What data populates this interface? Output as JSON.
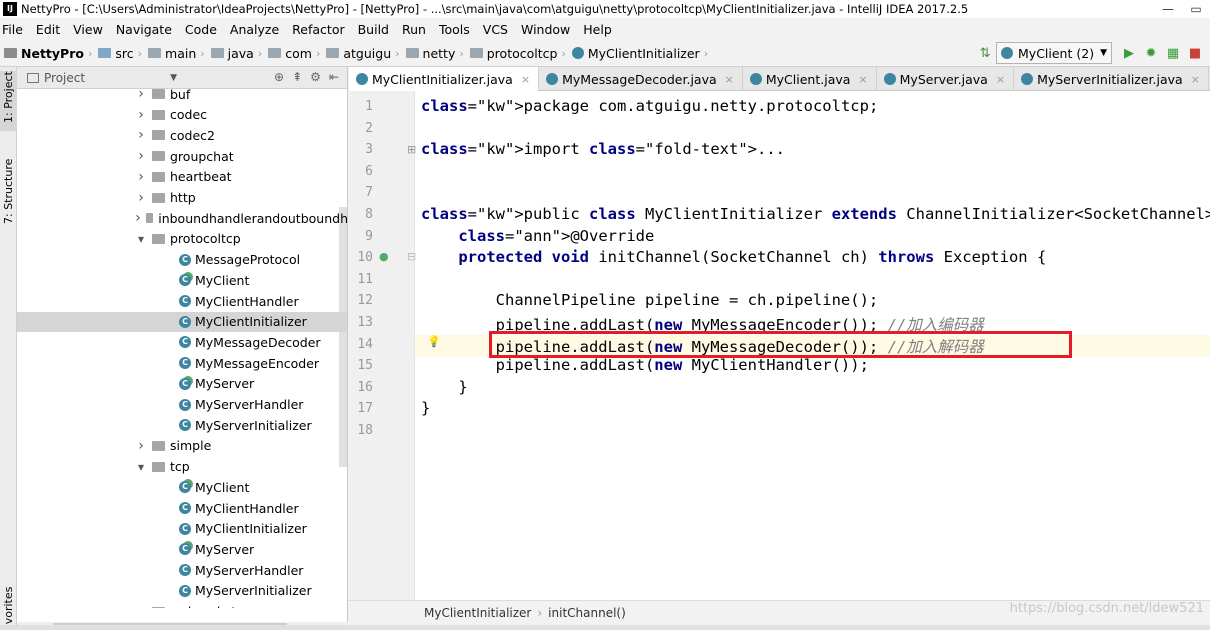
{
  "window": {
    "title": "NettyPro - [C:\\Users\\Administrator\\IdeaProjects\\NettyPro] - [NettyPro] - ...\\src\\main\\java\\com\\atguigu\\netty\\protocoltcp\\MyClientInitializer.java - IntelliJ IDEA 2017.2.5",
    "app_icon": "IJ"
  },
  "menu": [
    "File",
    "Edit",
    "View",
    "Navigate",
    "Code",
    "Analyze",
    "Refactor",
    "Build",
    "Run",
    "Tools",
    "VCS",
    "Window",
    "Help"
  ],
  "breadcrumb": [
    "NettyPro",
    "src",
    "main",
    "java",
    "com",
    "atguigu",
    "netty",
    "protocoltcp",
    "MyClientInitializer"
  ],
  "run_config": "MyClient (2)",
  "side_tabs": {
    "project": "1: Project",
    "structure": "7: Structure",
    "favorites": "avorites"
  },
  "project_panel": {
    "title": "Project"
  },
  "tree": [
    {
      "label": "buf",
      "type": "pkg",
      "expanded": false
    },
    {
      "label": "codec",
      "type": "pkg",
      "expanded": false
    },
    {
      "label": "codec2",
      "type": "pkg",
      "expanded": false
    },
    {
      "label": "groupchat",
      "type": "pkg",
      "expanded": false
    },
    {
      "label": "heartbeat",
      "type": "pkg",
      "expanded": false
    },
    {
      "label": "http",
      "type": "pkg",
      "expanded": false
    },
    {
      "label": "inboundhandlerandoutboundh",
      "type": "pkg",
      "expanded": false
    },
    {
      "label": "protocoltcp",
      "type": "pkg",
      "expanded": true
    },
    {
      "label": "MessageProtocol",
      "type": "class"
    },
    {
      "label": "MyClient",
      "type": "runnable"
    },
    {
      "label": "MyClientHandler",
      "type": "class"
    },
    {
      "label": "MyClientInitializer",
      "type": "class",
      "selected": true
    },
    {
      "label": "MyMessageDecoder",
      "type": "class"
    },
    {
      "label": "MyMessageEncoder",
      "type": "class"
    },
    {
      "label": "MyServer",
      "type": "runnable"
    },
    {
      "label": "MyServerHandler",
      "type": "class"
    },
    {
      "label": "MyServerInitializer",
      "type": "class"
    },
    {
      "label": "simple",
      "type": "pkg",
      "expanded": false
    },
    {
      "label": "tcp",
      "type": "pkg",
      "expanded": true
    },
    {
      "label": "MyClient",
      "type": "runnable"
    },
    {
      "label": "MyClientHandler",
      "type": "class"
    },
    {
      "label": "MyClientInitializer",
      "type": "class"
    },
    {
      "label": "MyServer",
      "type": "runnable"
    },
    {
      "label": "MyServerHandler",
      "type": "class"
    },
    {
      "label": "MyServerInitializer",
      "type": "class"
    },
    {
      "label": "websocket",
      "type": "pkg",
      "expanded": false
    }
  ],
  "tabs": [
    {
      "label": "MyClientInitializer.java",
      "active": true
    },
    {
      "label": "MyMessageDecoder.java",
      "active": false
    },
    {
      "label": "MyClient.java",
      "active": false
    },
    {
      "label": "MyServer.java",
      "active": false
    },
    {
      "label": "MyServerInitializer.java",
      "active": false
    }
  ],
  "code_lines": [
    {
      "num": "1",
      "text": "package com.atguigu.netty.protocoltcp;"
    },
    {
      "num": "2",
      "text": ""
    },
    {
      "num": "3",
      "text": "import ..."
    },
    {
      "num": "6",
      "text": ""
    },
    {
      "num": "7",
      "text": ""
    },
    {
      "num": "8",
      "text": "public class MyClientInitializer extends ChannelInitializer<SocketChannel> {"
    },
    {
      "num": "9",
      "text": "    @Override"
    },
    {
      "num": "10",
      "text": "    protected void initChannel(SocketChannel ch) throws Exception {"
    },
    {
      "num": "11",
      "text": ""
    },
    {
      "num": "12",
      "text": "        ChannelPipeline pipeline = ch.pipeline();"
    },
    {
      "num": "13",
      "text": "        pipeline.addLast(new MyMessageEncoder()); //加入编码器"
    },
    {
      "num": "14",
      "text": "        pipeline.addLast(new MyMessageDecoder()); //加入解码器"
    },
    {
      "num": "15",
      "text": "        pipeline.addLast(new MyClientHandler());"
    },
    {
      "num": "16",
      "text": "    }"
    },
    {
      "num": "17",
      "text": "}"
    },
    {
      "num": "18",
      "text": ""
    }
  ],
  "editor_footer": [
    "MyClientInitializer",
    "initChannel()"
  ],
  "watermark": "https://blog.csdn.net/ldew521",
  "colors": {
    "highlight_box": "#e51c23",
    "keyword": "#000080",
    "annotation": "#808000",
    "comment": "#808080"
  }
}
